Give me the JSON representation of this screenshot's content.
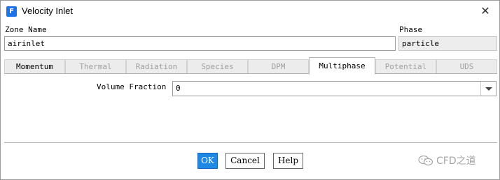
{
  "window": {
    "title": "Velocity Inlet",
    "icon_letter": "F",
    "close_icon": "✕"
  },
  "zone": {
    "label": "Zone Name",
    "value": "airinlet"
  },
  "phase": {
    "label": "Phase",
    "value": "particle"
  },
  "tabs": [
    {
      "label": "Momentum",
      "enabled": true,
      "active": false
    },
    {
      "label": "Thermal",
      "enabled": false,
      "active": false
    },
    {
      "label": "Radiation",
      "enabled": false,
      "active": false
    },
    {
      "label": "Species",
      "enabled": false,
      "active": false
    },
    {
      "label": "DPM",
      "enabled": false,
      "active": false
    },
    {
      "label": "Multiphase",
      "enabled": true,
      "active": true
    },
    {
      "label": "Potential",
      "enabled": false,
      "active": false
    },
    {
      "label": "UDS",
      "enabled": false,
      "active": false
    }
  ],
  "multiphase": {
    "volume_fraction_label": "Volume Fraction",
    "volume_fraction_value": "0"
  },
  "buttons": {
    "ok": "OK",
    "cancel": "Cancel",
    "help": "Help"
  },
  "watermark": {
    "text": "CFD之道",
    "icon": "wechat-logo"
  },
  "colors": {
    "accent": "#1e88e5",
    "icon_bg": "#1a73e8"
  }
}
